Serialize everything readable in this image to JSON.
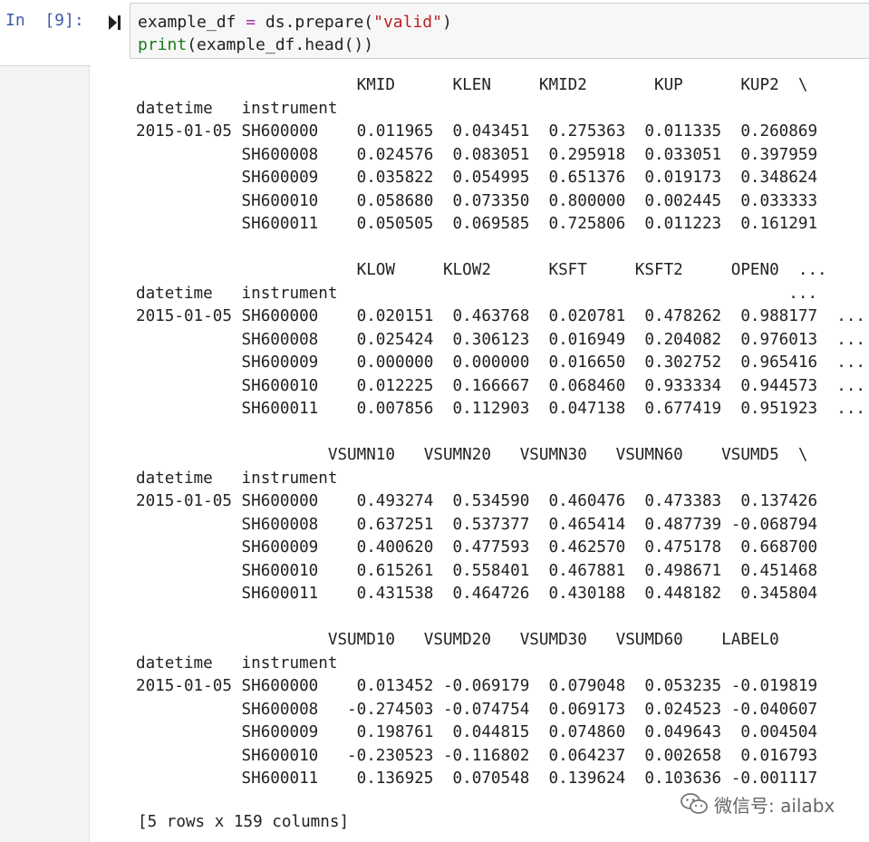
{
  "cell": {
    "prompt": "In  [9]:",
    "code": {
      "line1": {
        "var": "example_df",
        "op": "=",
        "call": "ds.prepare(",
        "arg": "\"valid\"",
        "close": ")"
      },
      "line2": {
        "builtin": "print",
        "rest": "(example_df.head())"
      }
    }
  },
  "output": {
    "lines": [
      "                       KMID      KLEN     KMID2       KUP      KUP2  \\",
      "datetime   instrument                                                 ",
      "2015-01-05 SH600000    0.011965  0.043451  0.275363  0.011335  0.260869   ",
      "           SH600008    0.024576  0.083051  0.295918  0.033051  0.397959   ",
      "           SH600009    0.035822  0.054995  0.651376  0.019173  0.348624   ",
      "           SH600010    0.058680  0.073350  0.800000  0.002445  0.033333   ",
      "           SH600011    0.050505  0.069585  0.725806  0.011223  0.161291   ",
      "",
      "                       KLOW     KLOW2      KSFT     KSFT2     OPEN0  ...",
      "datetime   instrument                                               ...",
      "2015-01-05 SH600000    0.020151  0.463768  0.020781  0.478262  0.988177  ...",
      "           SH600008    0.025424  0.306123  0.016949  0.204082  0.976013  ...",
      "           SH600009    0.000000  0.000000  0.016650  0.302752  0.965416  ...",
      "           SH600010    0.012225  0.166667  0.068460  0.933334  0.944573  ...",
      "           SH600011    0.007856  0.112903  0.047138  0.677419  0.951923  ...",
      "",
      "                    VSUMN10   VSUMN20   VSUMN30   VSUMN60    VSUMD5  \\",
      "datetime   instrument                                                 ",
      "2015-01-05 SH600000    0.493274  0.534590  0.460476  0.473383  0.137426   ",
      "           SH600008    0.637251  0.537377  0.465414  0.487739 -0.068794   ",
      "           SH600009    0.400620  0.477593  0.462570  0.475178  0.668700   ",
      "           SH600010    0.615261  0.558401  0.467881  0.498671  0.451468   ",
      "           SH600011    0.431538  0.464726  0.430188  0.448182  0.345804   ",
      "",
      "                    VSUMD10   VSUMD20   VSUMD30   VSUMD60    LABEL0",
      "datetime   instrument                                               ",
      "2015-01-05 SH600000    0.013452 -0.069179  0.079048  0.053235 -0.019819",
      "           SH600008   -0.274503 -0.074754  0.069173  0.024523 -0.040607",
      "           SH600009    0.198761  0.044815  0.074860  0.049643  0.004504",
      "           SH600010   -0.230523 -0.116802  0.064237  0.002658  0.016793",
      "           SH600011    0.136925  0.070548  0.139624  0.103636 -0.001117"
    ],
    "footer": "[5 rows x 159 columns]"
  },
  "watermark": {
    "text": "微信号: ailabx",
    "icon": "wechat-icon"
  },
  "colors": {
    "prompt": "#3f5ea8",
    "string": "#ba2121",
    "builtin": "#1a7a1a",
    "operator": "#a32fa6",
    "input_bg": "#f7f7f7"
  }
}
